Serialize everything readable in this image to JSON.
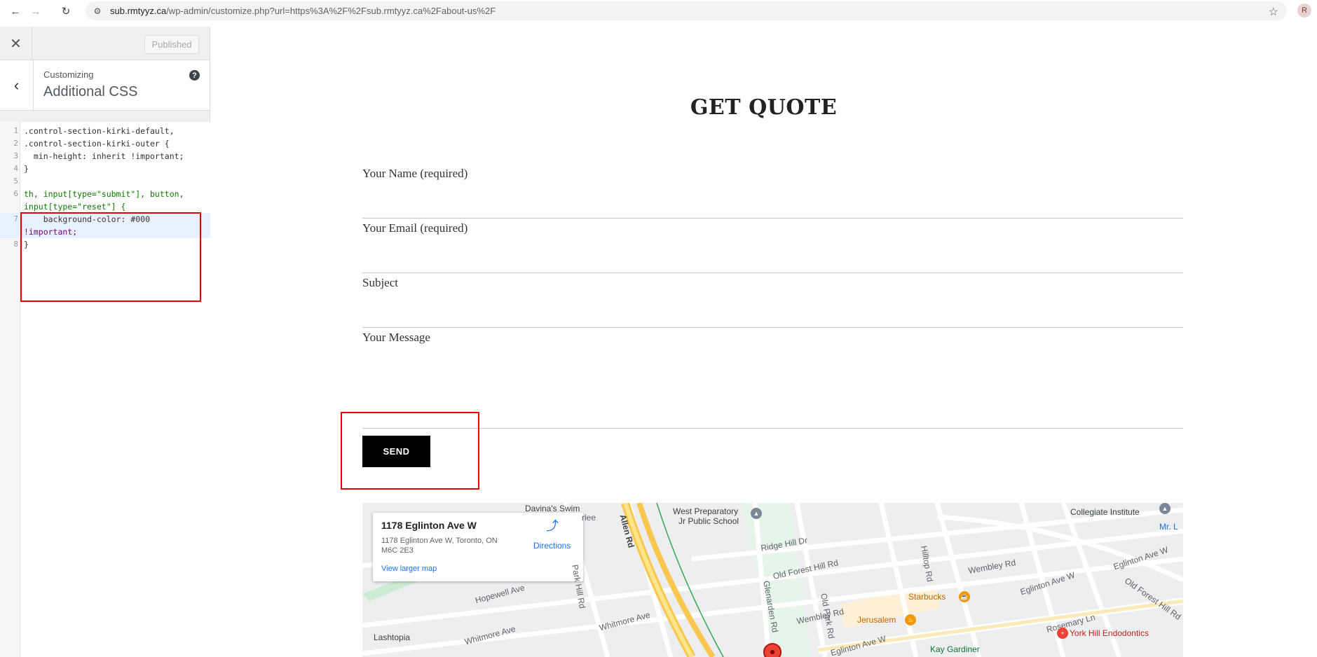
{
  "browser": {
    "url_host": "sub.rmtyyz.ca",
    "url_path": "/wp-admin/customize.php?url=https%3A%2F%2Fsub.rmtyyz.ca%2Fabout-us%2F",
    "profile_initial": "R"
  },
  "customizer": {
    "published_label": "Published",
    "customizing_label": "Customizing",
    "section_title": "Additional CSS",
    "help_glyph": "?"
  },
  "code": {
    "lines": [
      {
        "n": "1",
        "text": ".control-section-kirki-default,"
      },
      {
        "n": "2",
        "text": ".control-section-kirki-outer {"
      },
      {
        "n": "3",
        "text": "  min-height: inherit !important;"
      },
      {
        "n": "4",
        "text": "}"
      },
      {
        "n": "5",
        "text": ""
      },
      {
        "n": "6",
        "text": "th, input[type=\"submit\"], button,"
      },
      {
        "n": "",
        "text": "input[type=\"reset\"] {"
      },
      {
        "n": "7",
        "text": "    background-color: #000"
      },
      {
        "n": "",
        "text": "!important;"
      },
      {
        "n": "8",
        "text": "}"
      }
    ]
  },
  "preview": {
    "heading": "GET QUOTE",
    "fields": {
      "name": "Your Name (required)",
      "email": "Your Email (required)",
      "subject": "Subject",
      "message": "Your Message"
    },
    "send_label": "SEND"
  },
  "map": {
    "card": {
      "title": "1178 Eglinton Ave W",
      "address": "1178 Eglinton Ave W, Toronto, ON M6C 2E3",
      "directions": "Directions",
      "view_larger": "View larger map"
    },
    "labels": {
      "davinas": "Davina's Swim",
      "davinas2": "rlee",
      "west_prep": "West Preparatory",
      "west_prep2": "Jr Public School",
      "collegiate": "Collegiate Institute",
      "mr": "Mr. L",
      "allen": "Allen Rd",
      "ridge_hill": "Ridge Hill Dr",
      "hilltop": "Hilltop Rd",
      "wembley1": "Wembley Rd",
      "eglinton1": "Eglinton Ave W",
      "eglinton2": "Eglinton Ave W",
      "eglinton3": "Eglinton Ave W",
      "old_forest1": "Old Forest Hill Rd",
      "old_forest2": "Old Forest Hill Rd",
      "park_hill": "Park Hill Rd",
      "hopewell": "Hopewell Ave",
      "glenarden": "Glenarden Rd",
      "old_park": "Old Park Rd",
      "starbucks": "Starbucks",
      "wembley2": "Wembley Rd",
      "jerusalem": "Jerusalem",
      "rosemary": "Rosemary Ln",
      "whitmore1": "Whitmore Ave",
      "whitmore2": "Whitmore Ave",
      "lashtopia": "Lashtopia",
      "kay": "Kay Gardiner",
      "york_hill": "York Hill Endodontics"
    }
  }
}
